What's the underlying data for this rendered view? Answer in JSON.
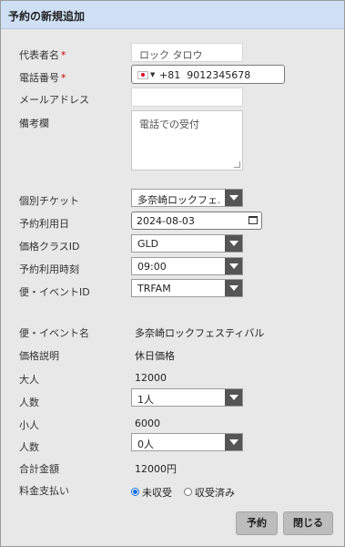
{
  "dialog": {
    "title": "予約の新規追加"
  },
  "form": {
    "representative": {
      "label": "代表者名",
      "required_mark": "*",
      "value": "ロック タロウ"
    },
    "phone": {
      "label": "電話番号",
      "required_mark": "*",
      "dial_code": "+81",
      "number": "9012345678"
    },
    "email": {
      "label": "メールアドレス",
      "value": ""
    },
    "remarks": {
      "label": "備考欄",
      "value": "電話での受付"
    },
    "ticket": {
      "label": "個別チケット",
      "selected": "多奈崎ロックフェ..."
    },
    "date": {
      "label": "予約利用日",
      "value": "2024-08-03"
    },
    "price_class": {
      "label": "価格クラスID",
      "selected": "GLD"
    },
    "time": {
      "label": "予約利用時刻",
      "selected": "09:00"
    },
    "event_id": {
      "label": "便・イベントID",
      "selected": "TRFAM"
    }
  },
  "details": {
    "event_name": {
      "label": "便・イベント名",
      "value": "多奈崎ロックフェスティバル"
    },
    "price_desc": {
      "label": "価格説明",
      "value": "休日価格"
    },
    "adult": {
      "label": "大人",
      "value": "12000"
    },
    "adult_count": {
      "label": "人数",
      "selected": "1人"
    },
    "child": {
      "label": "小人",
      "value": "6000"
    },
    "child_count": {
      "label": "人数",
      "selected": "0人"
    },
    "total": {
      "label": "合計金額",
      "value": "12000円"
    },
    "payment": {
      "label": "料金支払い",
      "options": [
        "未収受",
        "収受済み"
      ],
      "selected": "未収受"
    }
  },
  "buttons": {
    "reserve": "予約",
    "close": "閉じる"
  }
}
